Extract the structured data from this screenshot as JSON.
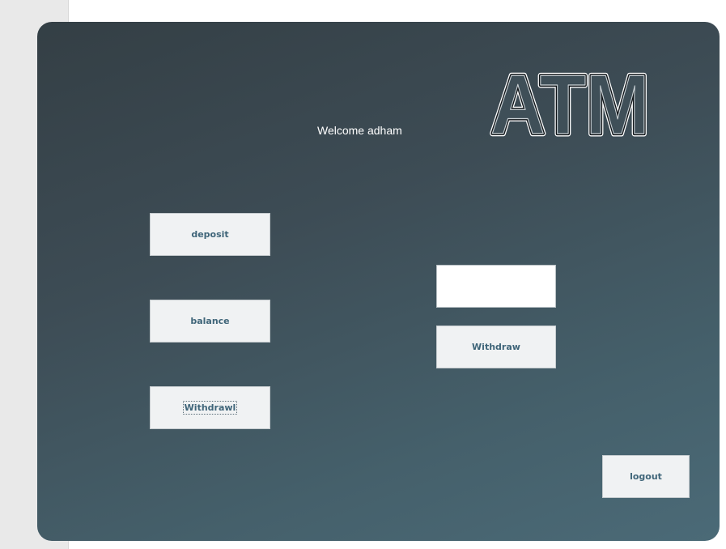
{
  "colors": {
    "panel_gradient": [
      "#343f45",
      "#4b6a77"
    ],
    "button_bg": "#f0f2f3",
    "button_text": "#3f6579",
    "welcome_text": "#ffffff"
  },
  "header": {
    "welcome": "Welcome adham",
    "logo_text": "ATM"
  },
  "menu": {
    "deposit_label": "deposit",
    "balance_label": "balance",
    "withdrawl_label": "Withdrawl"
  },
  "withdraw_panel": {
    "amount_value": "",
    "withdraw_label": "Withdraw"
  },
  "footer": {
    "logout_label": "logout"
  }
}
